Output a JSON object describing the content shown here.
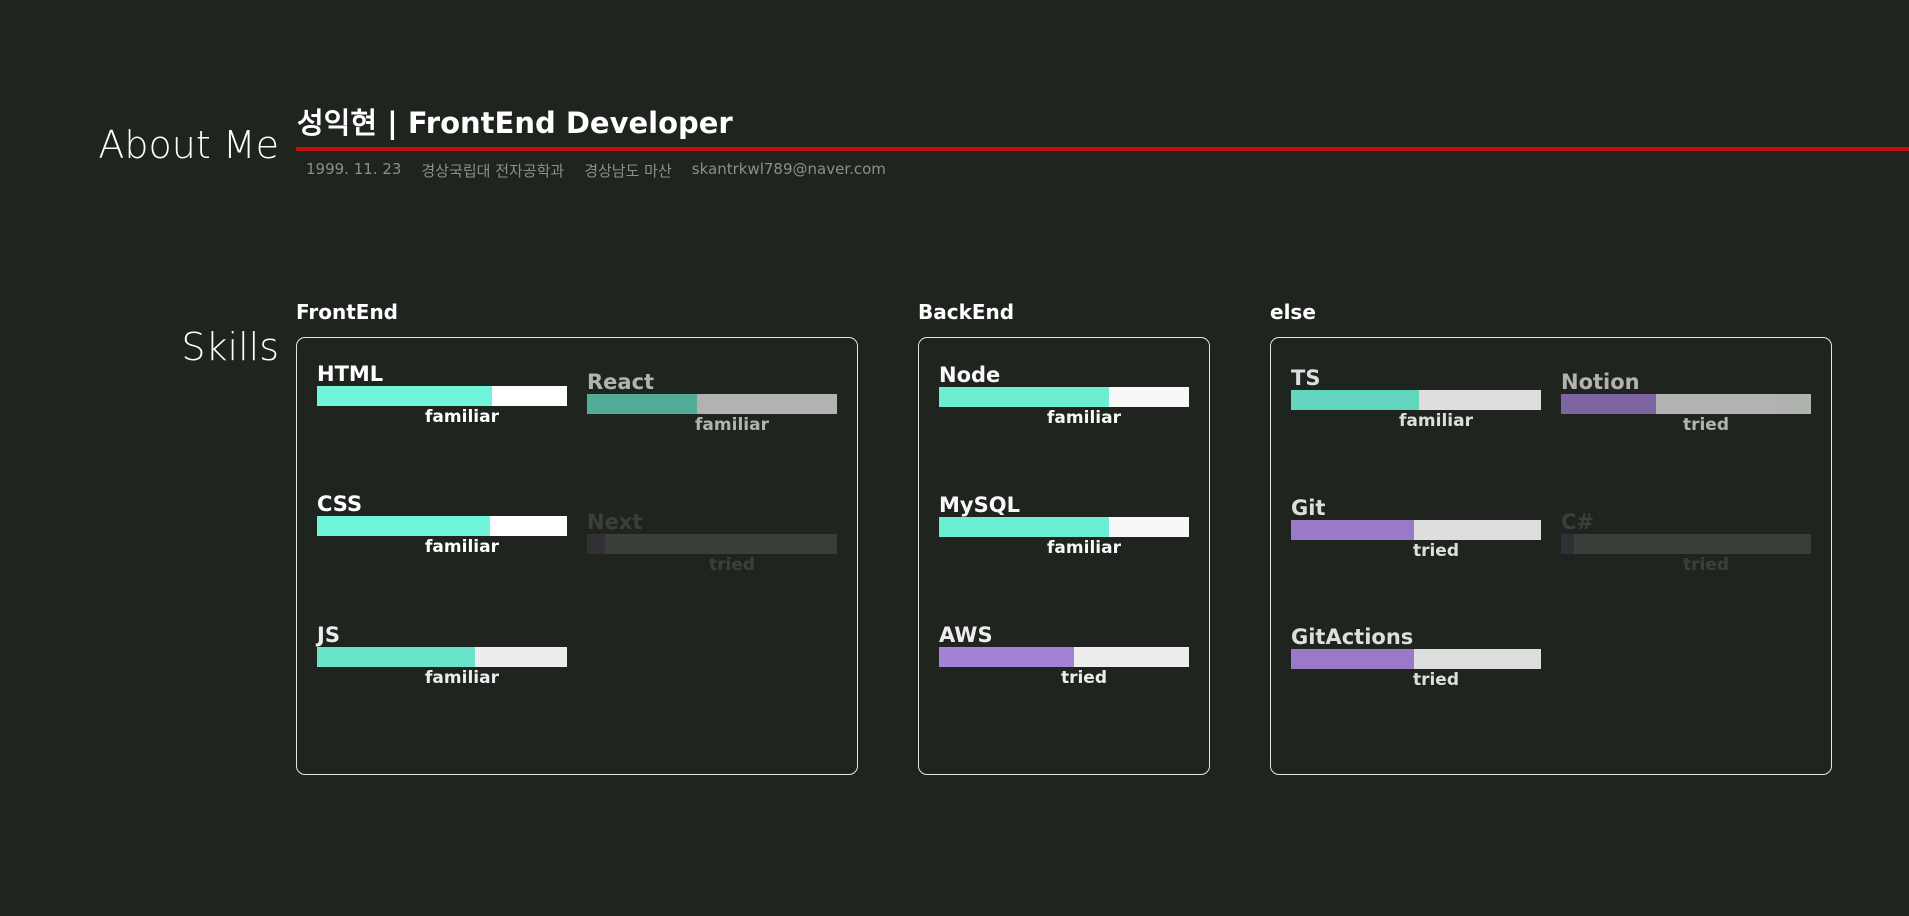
{
  "colors": {
    "background": "#1f241f",
    "accent_rule": "#c80f0f",
    "familiar": "#6ff5d9",
    "tried": "#b08ae6"
  },
  "about": {
    "heading": "About Me",
    "name_title": "성익현 | FrontEnd Developer",
    "info": [
      "1999. 11. 23",
      "경상국립대 전자공학과",
      "경상남도 마산",
      "skantrkwl789@naver.com"
    ]
  },
  "skills": {
    "heading": "Skills",
    "groups": [
      {
        "title": "FrontEnd",
        "items": [
          {
            "name": "HTML",
            "level": "familiar",
            "fill": 0.7,
            "opacity": 1.0
          },
          {
            "name": "CSS",
            "level": "familiar",
            "fill": 0.69,
            "opacity": 1.0
          },
          {
            "name": "JS",
            "level": "familiar",
            "fill": 0.63,
            "opacity": 0.92
          },
          {
            "name": "React",
            "level": "familiar",
            "fill": 0.44,
            "opacity": 0.65
          },
          {
            "name": "Next",
            "level": "tried",
            "fill": 0.07,
            "opacity": 0.12
          }
        ]
      },
      {
        "title": "BackEnd",
        "items": [
          {
            "name": "Node",
            "level": "familiar",
            "fill": 0.68,
            "opacity": 0.97
          },
          {
            "name": "MySQL",
            "level": "familiar",
            "fill": 0.68,
            "opacity": 0.97
          },
          {
            "name": "AWS",
            "level": "tried",
            "fill": 0.54,
            "opacity": 0.92
          }
        ]
      },
      {
        "title": "else",
        "items": [
          {
            "name": "TS",
            "level": "familiar",
            "fill": 0.51,
            "opacity": 0.85
          },
          {
            "name": "Notion",
            "level": "tried",
            "fill": 0.38,
            "opacity": 0.65
          },
          {
            "name": "Git",
            "level": "tried",
            "fill": 0.49,
            "opacity": 0.85
          },
          {
            "name": "C#",
            "level": "tried",
            "fill": 0.05,
            "opacity": 0.12
          },
          {
            "name": "GitActions",
            "level": "tried",
            "fill": 0.49,
            "opacity": 0.85
          }
        ]
      }
    ]
  }
}
